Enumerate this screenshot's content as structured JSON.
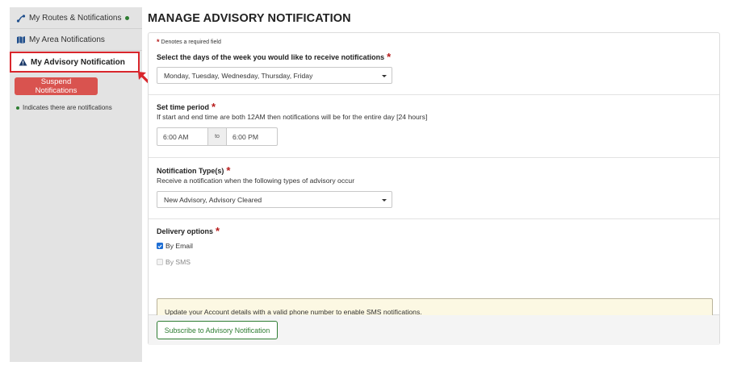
{
  "sidebar": {
    "items": [
      {
        "label": "My Routes & Notifications",
        "icon": "route-icon",
        "has_notifications": true
      },
      {
        "label": "My Area Notifications",
        "icon": "map-icon"
      },
      {
        "label": "My Advisory Notification",
        "icon": "warning-icon",
        "active": true
      }
    ],
    "suspend_button": "Suspend Notifications",
    "legend": "Indicates there are notifications"
  },
  "main": {
    "title": "MANAGE ADVISORY NOTIFICATION",
    "required_note": "Denotes a required field",
    "days": {
      "label": "Select the days of the week you would like to receive notifications",
      "value": "Monday, Tuesday, Wednesday, Thursday, Friday"
    },
    "time_period": {
      "label": "Set time period",
      "help": "If start and end time are both 12AM then notifications will be for the entire day [24 hours]",
      "start": "6:00 AM",
      "separator": "to",
      "end": "6:00 PM"
    },
    "notification_types": {
      "label": "Notification Type(s)",
      "help": "Receive a notification when the following types of advisory occur",
      "value": "New Advisory, Advisory Cleared"
    },
    "delivery": {
      "label": "Delivery options",
      "email": {
        "label": "By Email",
        "checked": true
      },
      "sms": {
        "label": "By SMS",
        "checked": false,
        "disabled": true
      },
      "alert": "Update your Account details with a valid phone number to enable SMS notifications."
    },
    "subscribe_button": "Subscribe to Advisory Notification"
  },
  "colors": {
    "accent_red": "#d9262c",
    "suspend_red": "#d9534f",
    "green": "#2e7d32",
    "required_star": "#b71c1c",
    "alert_bg": "#fcf8e3",
    "sidebar_bg": "#e3e3e3"
  }
}
